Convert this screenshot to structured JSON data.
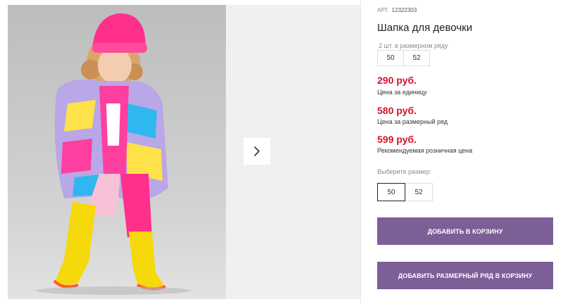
{
  "product": {
    "article_label": "АРТ.",
    "article_code": "12322303",
    "title": "Шапка для девочки",
    "range": {
      "caption": "2 шт. в размерном ряду",
      "sizes": [
        "50",
        "52"
      ]
    },
    "prices": [
      {
        "value": "290 руб.",
        "caption": "Цена за единицу"
      },
      {
        "value": "580 руб.",
        "caption": "Цена за размерный ряд"
      },
      {
        "value": "599 руб.",
        "caption": "Рекомендуемая розничная цена"
      }
    ],
    "size_select": {
      "label": "Выберите размер:",
      "options": [
        "50",
        "52"
      ],
      "selected": "50"
    },
    "buttons": {
      "add_to_cart": "ДОБАВИТЬ В КОРЗИНУ",
      "add_range_to_cart": "ДОБАВИТЬ РАЗМЕРНЫЙ РЯД В КОРЗИНУ"
    }
  },
  "gallery": {
    "next_icon": "chevron-right-icon"
  },
  "colors": {
    "price": "#d8112c",
    "button": "#7b5f97",
    "hat": "#ff2f8c",
    "boots": "#f5d90a"
  }
}
